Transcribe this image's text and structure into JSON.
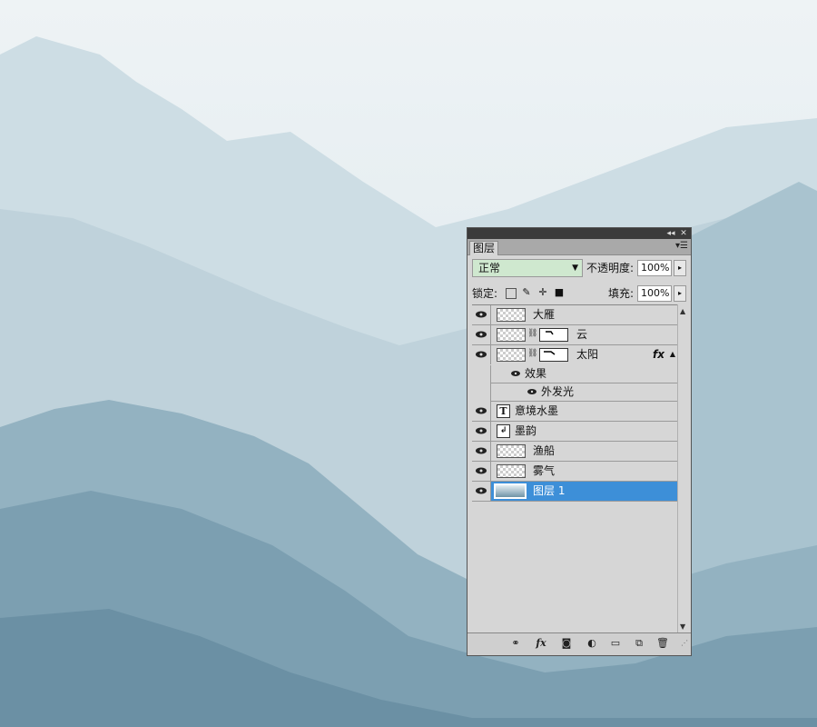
{
  "panel": {
    "tab_label": "图层",
    "blend_mode": "正常",
    "opacity_label": "不透明度:",
    "opacity_value": "100%",
    "lock_label": "锁定:",
    "fill_label": "填充:",
    "fill_value": "100%"
  },
  "layers": [
    {
      "name": "大雁",
      "visible": true
    },
    {
      "name": "云",
      "visible": true
    },
    {
      "name": "太阳",
      "visible": true,
      "effects_label": "效果",
      "effect": "外发光"
    },
    {
      "name": "意境水墨",
      "visible": true,
      "type": "text"
    },
    {
      "name": "墨韵",
      "visible": true,
      "type": "smart"
    },
    {
      "name": "渔船",
      "visible": true
    },
    {
      "name": "雾气",
      "visible": true
    },
    {
      "name": "图层 1",
      "visible": true,
      "selected": true
    }
  ],
  "colors": {
    "selected": "#3d8fd8",
    "blend_field": "#cfe8cf"
  }
}
